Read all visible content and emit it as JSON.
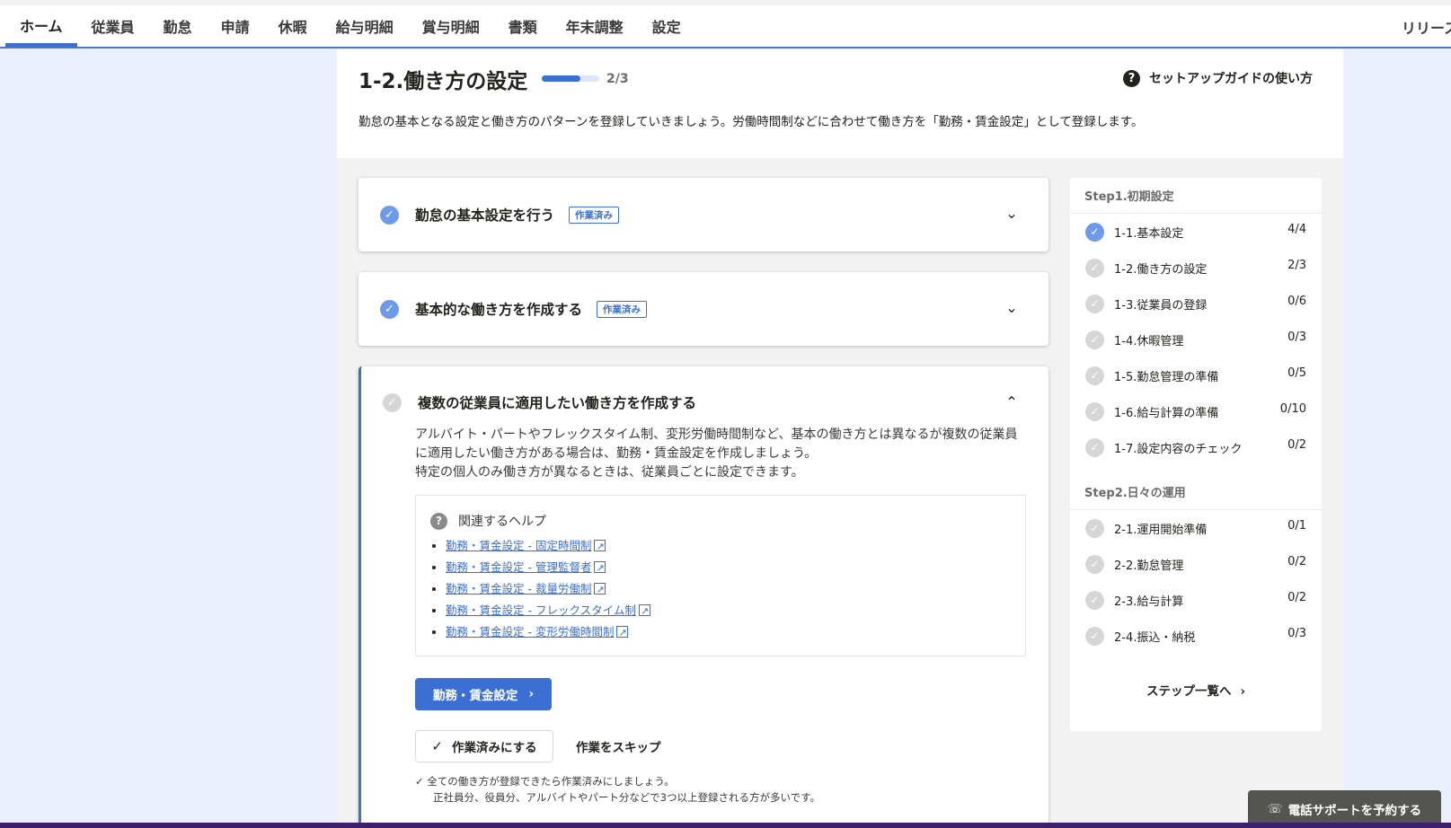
{
  "nav": {
    "items": [
      "ホーム",
      "従業員",
      "勤怠",
      "申請",
      "休暇",
      "給与明細",
      "賞与明細",
      "書類",
      "年末調整",
      "設定"
    ],
    "release": "リリース"
  },
  "header": {
    "title": "1-2.働き方の設定",
    "progress_text": "2/3",
    "progress_fraction": 0.67,
    "guide_label": "セットアップガイドの使い方",
    "description": "勤怠の基本となる設定と働き方のパターンを登録していきましょう。労働時間制などに合わせて働き方を「勤務・賃金設定」として登録します。"
  },
  "cards": [
    {
      "title": "勤怠の基本設定を行う",
      "badge": "作業済み"
    },
    {
      "title": "基本的な働き方を作成する",
      "badge": "作業済み"
    },
    {
      "title": "複数の従業員に適用したい働き方を作成する",
      "body1": "アルバイト・パートやフレックスタイム制、変形労働時間制など、基本の働き方とは異なるが複数の従業員",
      "body2": "に適用したい働き方がある場合は、勤務・賃金設定を作成しましょう。",
      "body3": "特定の個人のみ働き方が異なるときは、従業員ごとに設定できます。",
      "help_title": "関連するヘルプ",
      "help_links": [
        "勤務・賃金設定 - 固定時間制",
        "勤務・賃金設定 - 管理監督者",
        "勤務・賃金設定 - 裁量労働制",
        "勤務・賃金設定 - フレックスタイム制",
        "勤務・賃金設定 - 変形労働時間制"
      ],
      "primary_button": "勤務・賃金設定",
      "done_button": "作業済みにする",
      "skip_button": "作業をスキップ",
      "note1": "全ての働き方が登録できたら作業済みにしましょう。",
      "note2": "正社員分、役員分、アルバイトやパート分などで3つ以上登録される方が多いです。"
    }
  ],
  "sidebar": {
    "step1_title": "Step1.初期設定",
    "step1_items": [
      {
        "label": "1-1.基本設定",
        "count": "4/4"
      },
      {
        "label": "1-2.働き方の設定",
        "count": "2/3"
      },
      {
        "label": "1-3.従業員の登録",
        "count": "0/6"
      },
      {
        "label": "1-4.休暇管理",
        "count": "0/3"
      },
      {
        "label": "1-5.勤怠管理の準備",
        "count": "0/5"
      },
      {
        "label": "1-6.給与計算の準備",
        "count": "0/10"
      },
      {
        "label": "1-7.設定内容のチェック",
        "count": "0/2"
      }
    ],
    "step2_title": "Step2.日々の運用",
    "step2_items": [
      {
        "label": "2-1.運用開始準備",
        "count": "0/1"
      },
      {
        "label": "2-2.勤怠管理",
        "count": "0/2"
      },
      {
        "label": "2-3.給与計算",
        "count": "0/2"
      },
      {
        "label": "2-4.振込・納税",
        "count": "0/3"
      }
    ],
    "all_steps": "ステップ一覧へ"
  },
  "phone_button": "電話サポートを予約する",
  "colors": {
    "accent": "#3b6fd4",
    "check_done": "#6d9aeb",
    "check_pending": "#d6d6d6"
  }
}
